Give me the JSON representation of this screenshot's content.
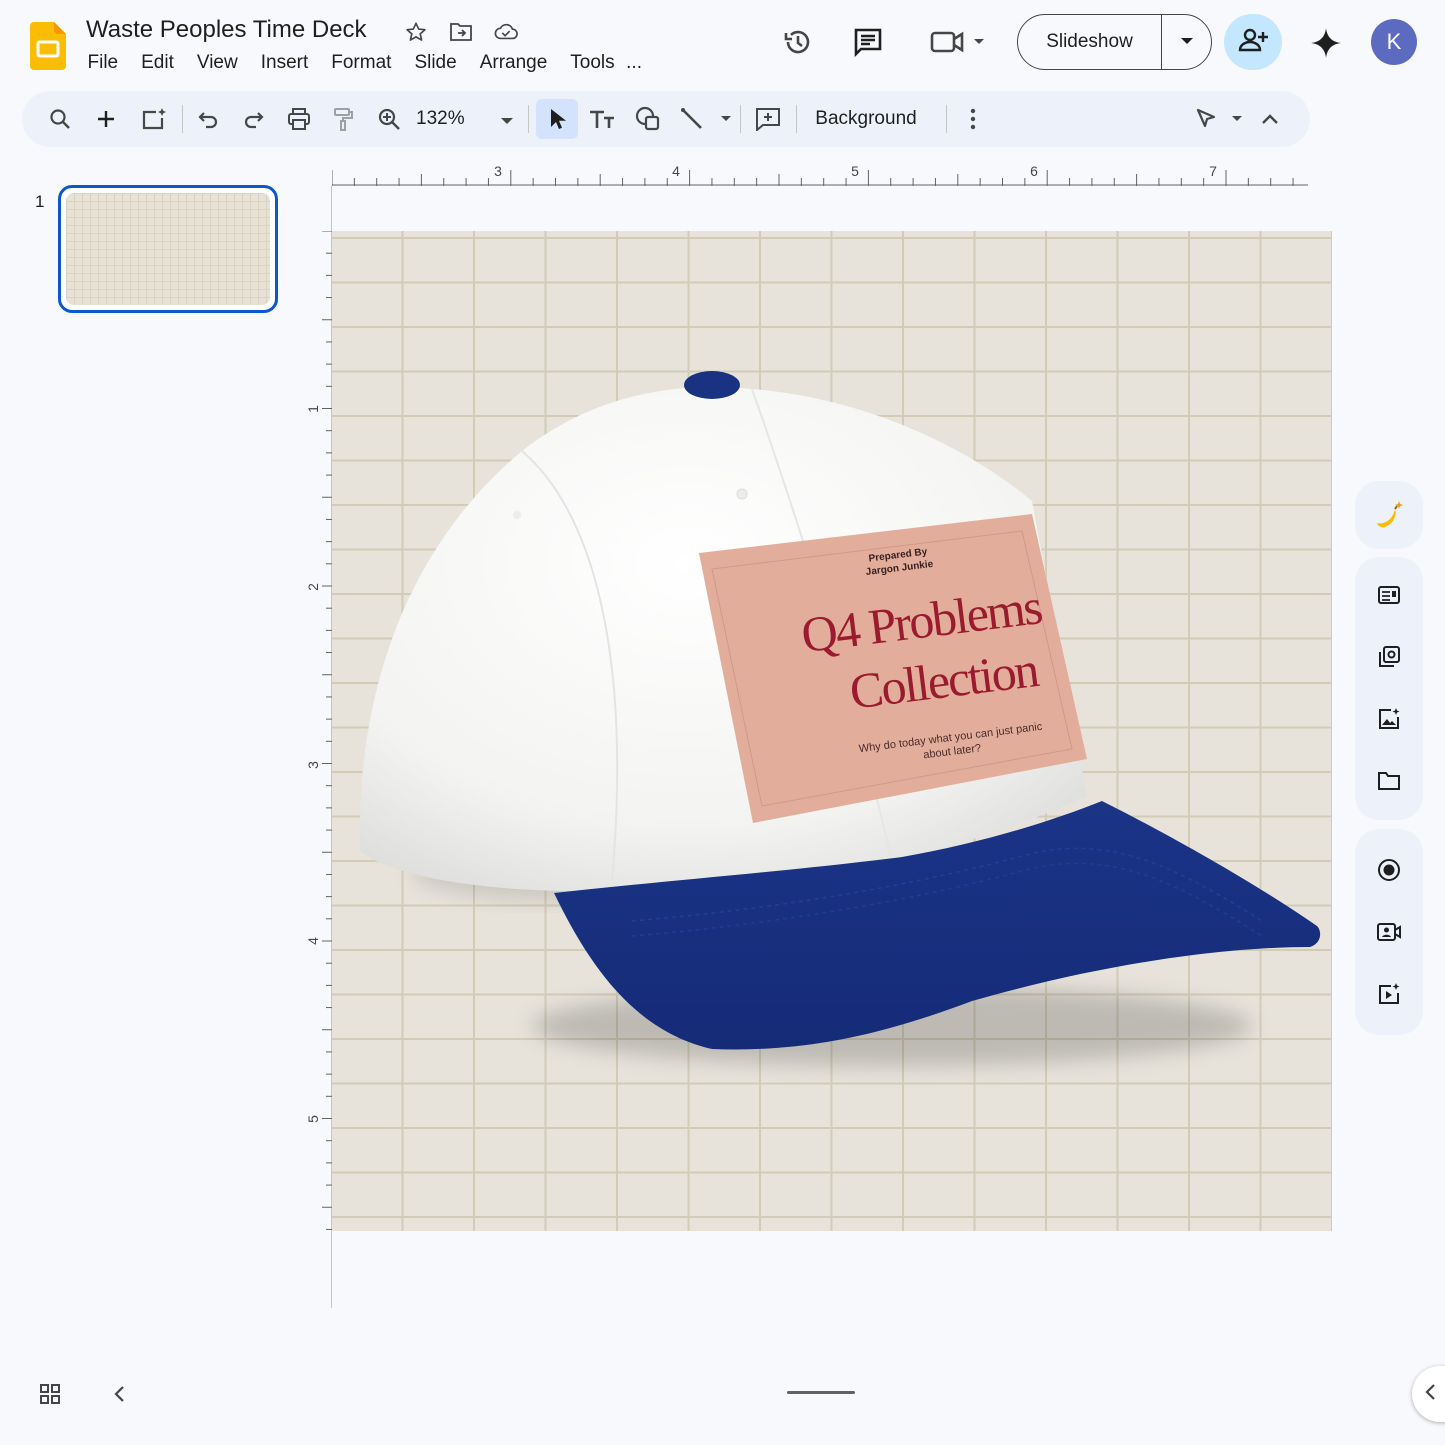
{
  "app": {
    "doc_title": "Waste Peoples Time Deck",
    "menu": [
      "File",
      "Edit",
      "View",
      "Insert",
      "Format",
      "Slide",
      "Arrange",
      "Tools",
      "..."
    ],
    "slideshow_label": "Slideshow",
    "avatar_initial": "K",
    "colors": {
      "accent": "#0b57d0",
      "share_bg": "#c2e7ff",
      "avatar_bg": "#5c6bc0",
      "logo": "#fbbc04"
    }
  },
  "toolbar": {
    "zoom": "132%",
    "background_label": "Background",
    "icons": [
      "search-icon",
      "add-icon",
      "new-slide-icon",
      "undo-icon",
      "redo-icon",
      "print-icon",
      "paint-format-icon",
      "zoom-icon",
      "select-icon",
      "text-box-icon",
      "shape-icon",
      "line-icon",
      "comment-icon",
      "more-icon",
      "cursor-mode-icon",
      "collapse-icon"
    ]
  },
  "filmstrip": {
    "slides": [
      {
        "number": "1"
      }
    ]
  },
  "rulers": {
    "top_labels": [
      "3",
      "4",
      "5",
      "6",
      "7"
    ],
    "left_labels": [
      "1",
      "2",
      "3",
      "4",
      "5"
    ]
  },
  "slide": {
    "label": {
      "prepared_by": "Prepared By",
      "author": "Jargon Junkie",
      "title_line1": "Q4 Problems",
      "title_line2": "Collection",
      "subtitle_line1": "Why do today what you can just panic",
      "subtitle_line2": "about later?"
    },
    "colors": {
      "crown": "#f5f5f3",
      "brim": "#1a3282",
      "button": "#1a3282",
      "label_bg": "#e2ae9b",
      "label_text": "#9b1b2e",
      "grid_bg": "#e7e3db",
      "grid_line": "#d2ccb7"
    }
  },
  "side_panel": {
    "icons": [
      "banana-sparkle-icon",
      "layout-icon",
      "copy-image-icon",
      "image-add-icon",
      "folder-icon",
      "record-icon",
      "camera-icon",
      "video-sparkle-icon"
    ]
  }
}
